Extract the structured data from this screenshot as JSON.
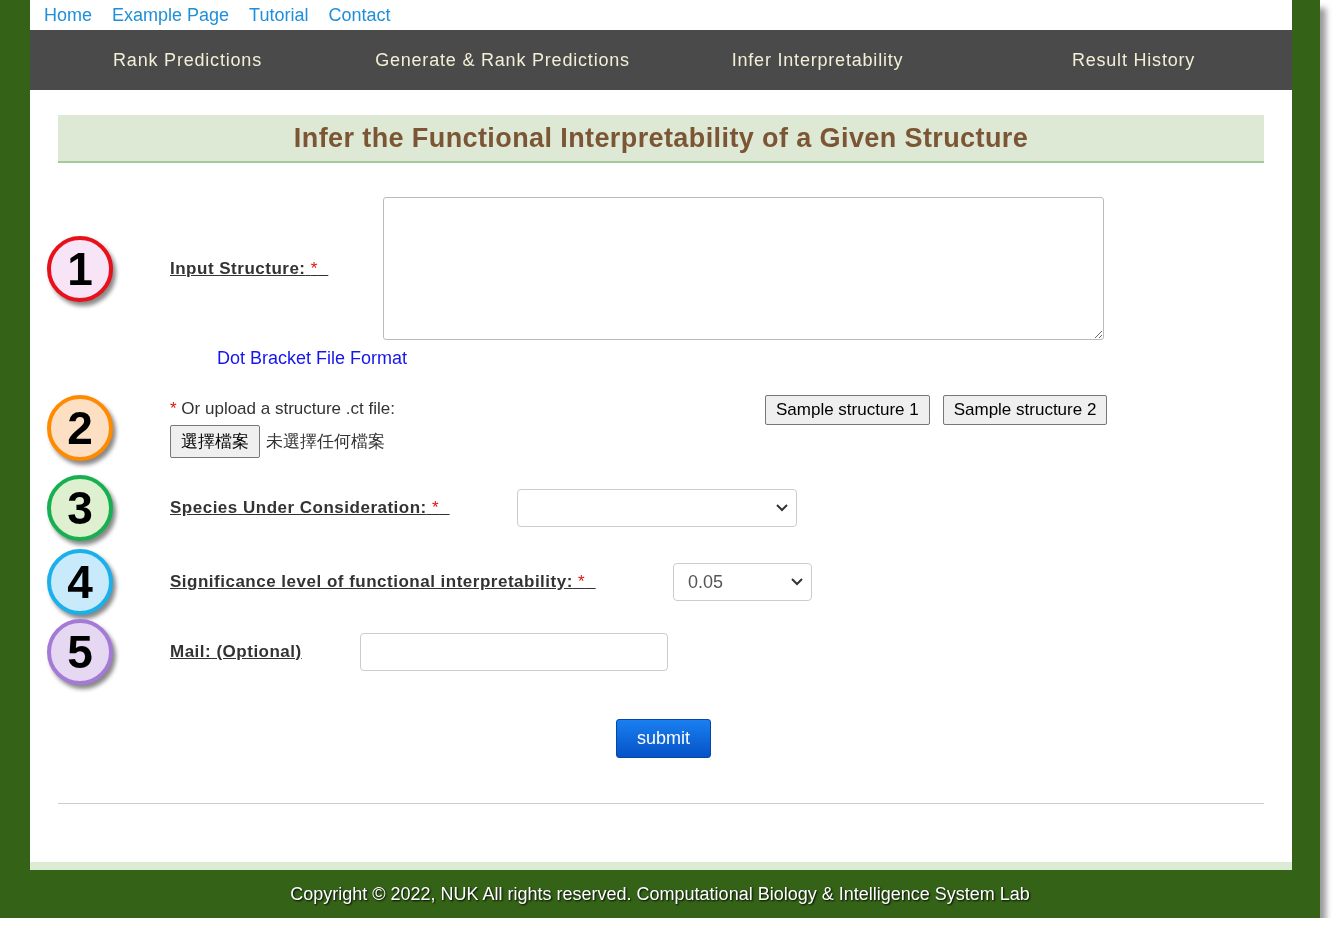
{
  "top_links": [
    "Home",
    "Example Page",
    "Tutorial",
    "Contact"
  ],
  "nav": [
    "Rank Predictions",
    "Generate & Rank Predictions",
    "Infer Interpretability",
    "Result History"
  ],
  "heading": "Infer the Functional Interpretability of a Given Structure",
  "steps": [
    {
      "number": "1",
      "color": "#e8101a"
    },
    {
      "number": "2",
      "color": "#ff8a00"
    },
    {
      "number": "3",
      "color": "#16b050"
    },
    {
      "number": "4",
      "color": "#1bb0ec"
    },
    {
      "number": "5",
      "color": "#a57ad6"
    }
  ],
  "structure": {
    "label": "Input Structure:",
    "required_mark": "*",
    "link": "Dot Bracket File Format"
  },
  "upload": {
    "required_mark": "*",
    "label": "Or upload a structure .ct file:",
    "button": "選擇檔案",
    "status": "未選擇任何檔案"
  },
  "samples": [
    "Sample structure 1",
    "Sample structure 2"
  ],
  "species": {
    "label": "Species Under Consideration:",
    "required_mark": "*"
  },
  "significance": {
    "label": "Significance level of functional interpretability:",
    "required_mark": "*",
    "value": "0.05"
  },
  "mail": {
    "label": "Mail: (Optional)"
  },
  "submit": "submit",
  "footer": "Copyright © 2022, NUK All rights reserved. Computational Biology & Intelligence System Lab"
}
